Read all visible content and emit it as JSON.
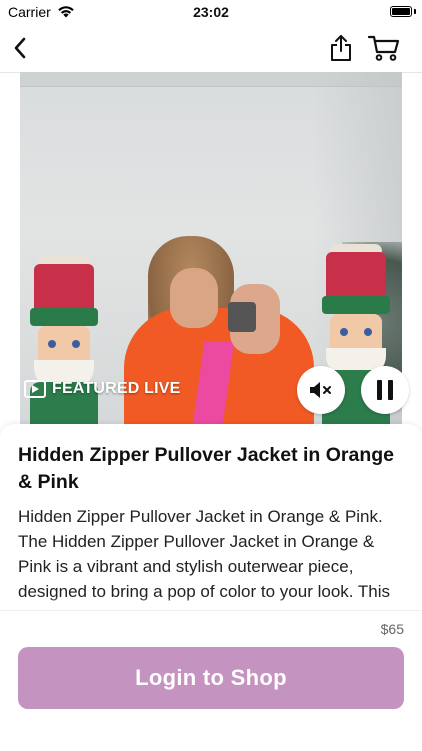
{
  "status_bar": {
    "carrier": "Carrier",
    "time": "23:02"
  },
  "nav": {
    "back_icon": "chevron-left-icon",
    "share_icon": "share-icon",
    "cart_icon": "cart-icon"
  },
  "video": {
    "badge_icon": "play-box-icon",
    "badge_label": "FEATURED LIVE",
    "mute_icon": "speaker-muted-icon",
    "pause_icon": "pause-icon"
  },
  "product": {
    "title": "Hidden Zipper Pullover Jacket in Orange & Pink",
    "description": "Hidden Zipper Pullover Jacket in Orange & Pink. The Hidden Zipper Pullover Jacket in Orange & Pink is a vibrant and stylish outerwear piece, designed to bring a pop of color to your look. This jacket features a hidden zipper...",
    "price": "$65"
  },
  "actions": {
    "login_label": "Login to Shop"
  },
  "colors": {
    "accent": "#c493c0",
    "price_text": "#666666"
  }
}
